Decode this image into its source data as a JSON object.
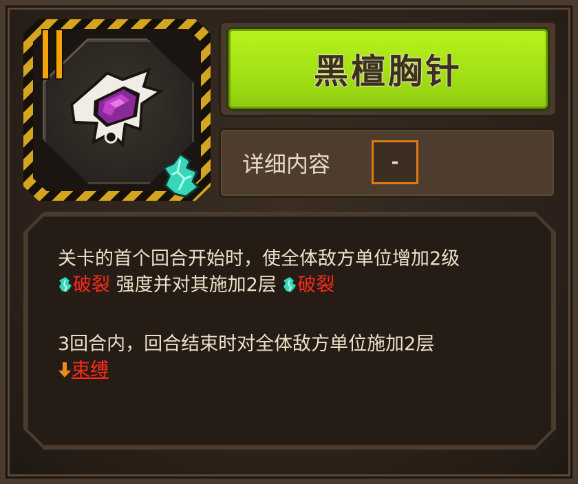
{
  "item": {
    "name": "黑檀胸针",
    "tier_icon": "tier-two-bars-icon",
    "item_icon": "brooch-icon",
    "badge_icon": "crack-crystal-icon"
  },
  "detail": {
    "label": "详细内容",
    "value": "-"
  },
  "description": {
    "para1_line1": "关卡的首个回合开始时，使全体敌方单位增加2级",
    "keyword_crack": "破裂",
    "para1_line2_mid": "强度并对其施加2层",
    "para2_line1": "3回合内，回合结束时对全体敌方单位施加2层",
    "keyword_bind": "束缚"
  },
  "colors": {
    "title_green": "#a3e114",
    "keyword_red": "#ff2a1a",
    "accent_orange": "#e07a10",
    "tier_orange": "#f5a30a",
    "crack_teal": "#3fe0c0"
  }
}
